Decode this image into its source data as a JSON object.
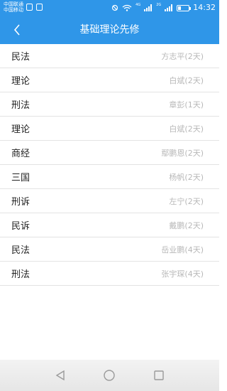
{
  "status_bar": {
    "carrier_1": "中国联通",
    "carrier_2": "中国移动",
    "net_1": "4G",
    "net_2": "2G",
    "time": "14:32",
    "icons": [
      "sim-icon",
      "image-icon",
      "nfc-icon",
      "wifi-icon",
      "signal-icon",
      "battery-icon"
    ],
    "battery_level": 0.3
  },
  "header": {
    "title": "基础理论先修",
    "back_icon": "chevron-left-icon",
    "background": "#2f96e8"
  },
  "items": [
    {
      "subject": "民法",
      "meta": "方志平(2天)"
    },
    {
      "subject": "理论",
      "meta": "白斌(2天)"
    },
    {
      "subject": "刑法",
      "meta": "章彭(1天)"
    },
    {
      "subject": "理论",
      "meta": "白斌(2天)"
    },
    {
      "subject": "商经",
      "meta": "鄢鹏恩(2天)"
    },
    {
      "subject": "三国",
      "meta": "杨帆(2天)"
    },
    {
      "subject": "刑诉",
      "meta": "左宁(2天)"
    },
    {
      "subject": "民诉",
      "meta": "戴鹏(2天)"
    },
    {
      "subject": "民法",
      "meta": "岳业鹏(4天)"
    },
    {
      "subject": "刑法",
      "meta": "张宇琛(4天)"
    }
  ],
  "navbar": {
    "icons": [
      "back-triangle-icon",
      "home-circle-icon",
      "recents-square-icon"
    ]
  }
}
